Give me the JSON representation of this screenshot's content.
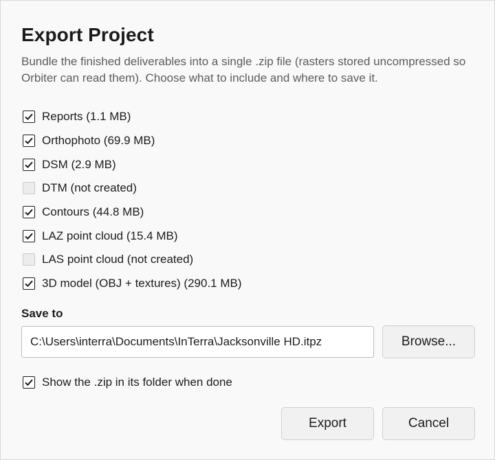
{
  "dialog": {
    "title": "Export Project",
    "description": "Bundle the finished deliverables into a single .zip file (rasters stored uncompressed so Orbiter can read them). Choose what to include and where to save it."
  },
  "options": [
    {
      "label": "Reports (1.1 MB)",
      "checked": true,
      "enabled": true
    },
    {
      "label": "Orthophoto (69.9 MB)",
      "checked": true,
      "enabled": true
    },
    {
      "label": "DSM (2.9 MB)",
      "checked": true,
      "enabled": true
    },
    {
      "label": "DTM (not created)",
      "checked": false,
      "enabled": false
    },
    {
      "label": "Contours (44.8 MB)",
      "checked": true,
      "enabled": true
    },
    {
      "label": "LAZ point cloud (15.4 MB)",
      "checked": true,
      "enabled": true
    },
    {
      "label": "LAS point cloud (not created)",
      "checked": false,
      "enabled": false
    },
    {
      "label": "3D model (OBJ + textures) (290.1 MB)",
      "checked": true,
      "enabled": true
    }
  ],
  "save": {
    "label": "Save to",
    "path": "C:\\Users\\interra\\Documents\\InTerra\\Jacksonville HD.itpz",
    "browse_label": "Browse..."
  },
  "show_in_folder": {
    "label": "Show the .zip in its folder when done",
    "checked": true
  },
  "actions": {
    "export_label": "Export",
    "cancel_label": "Cancel"
  },
  "colors": {
    "background": "#f9f9f9",
    "text": "#1b1b1b",
    "muted_text": "#5c5c5c",
    "disabled_box": "#ececec"
  }
}
